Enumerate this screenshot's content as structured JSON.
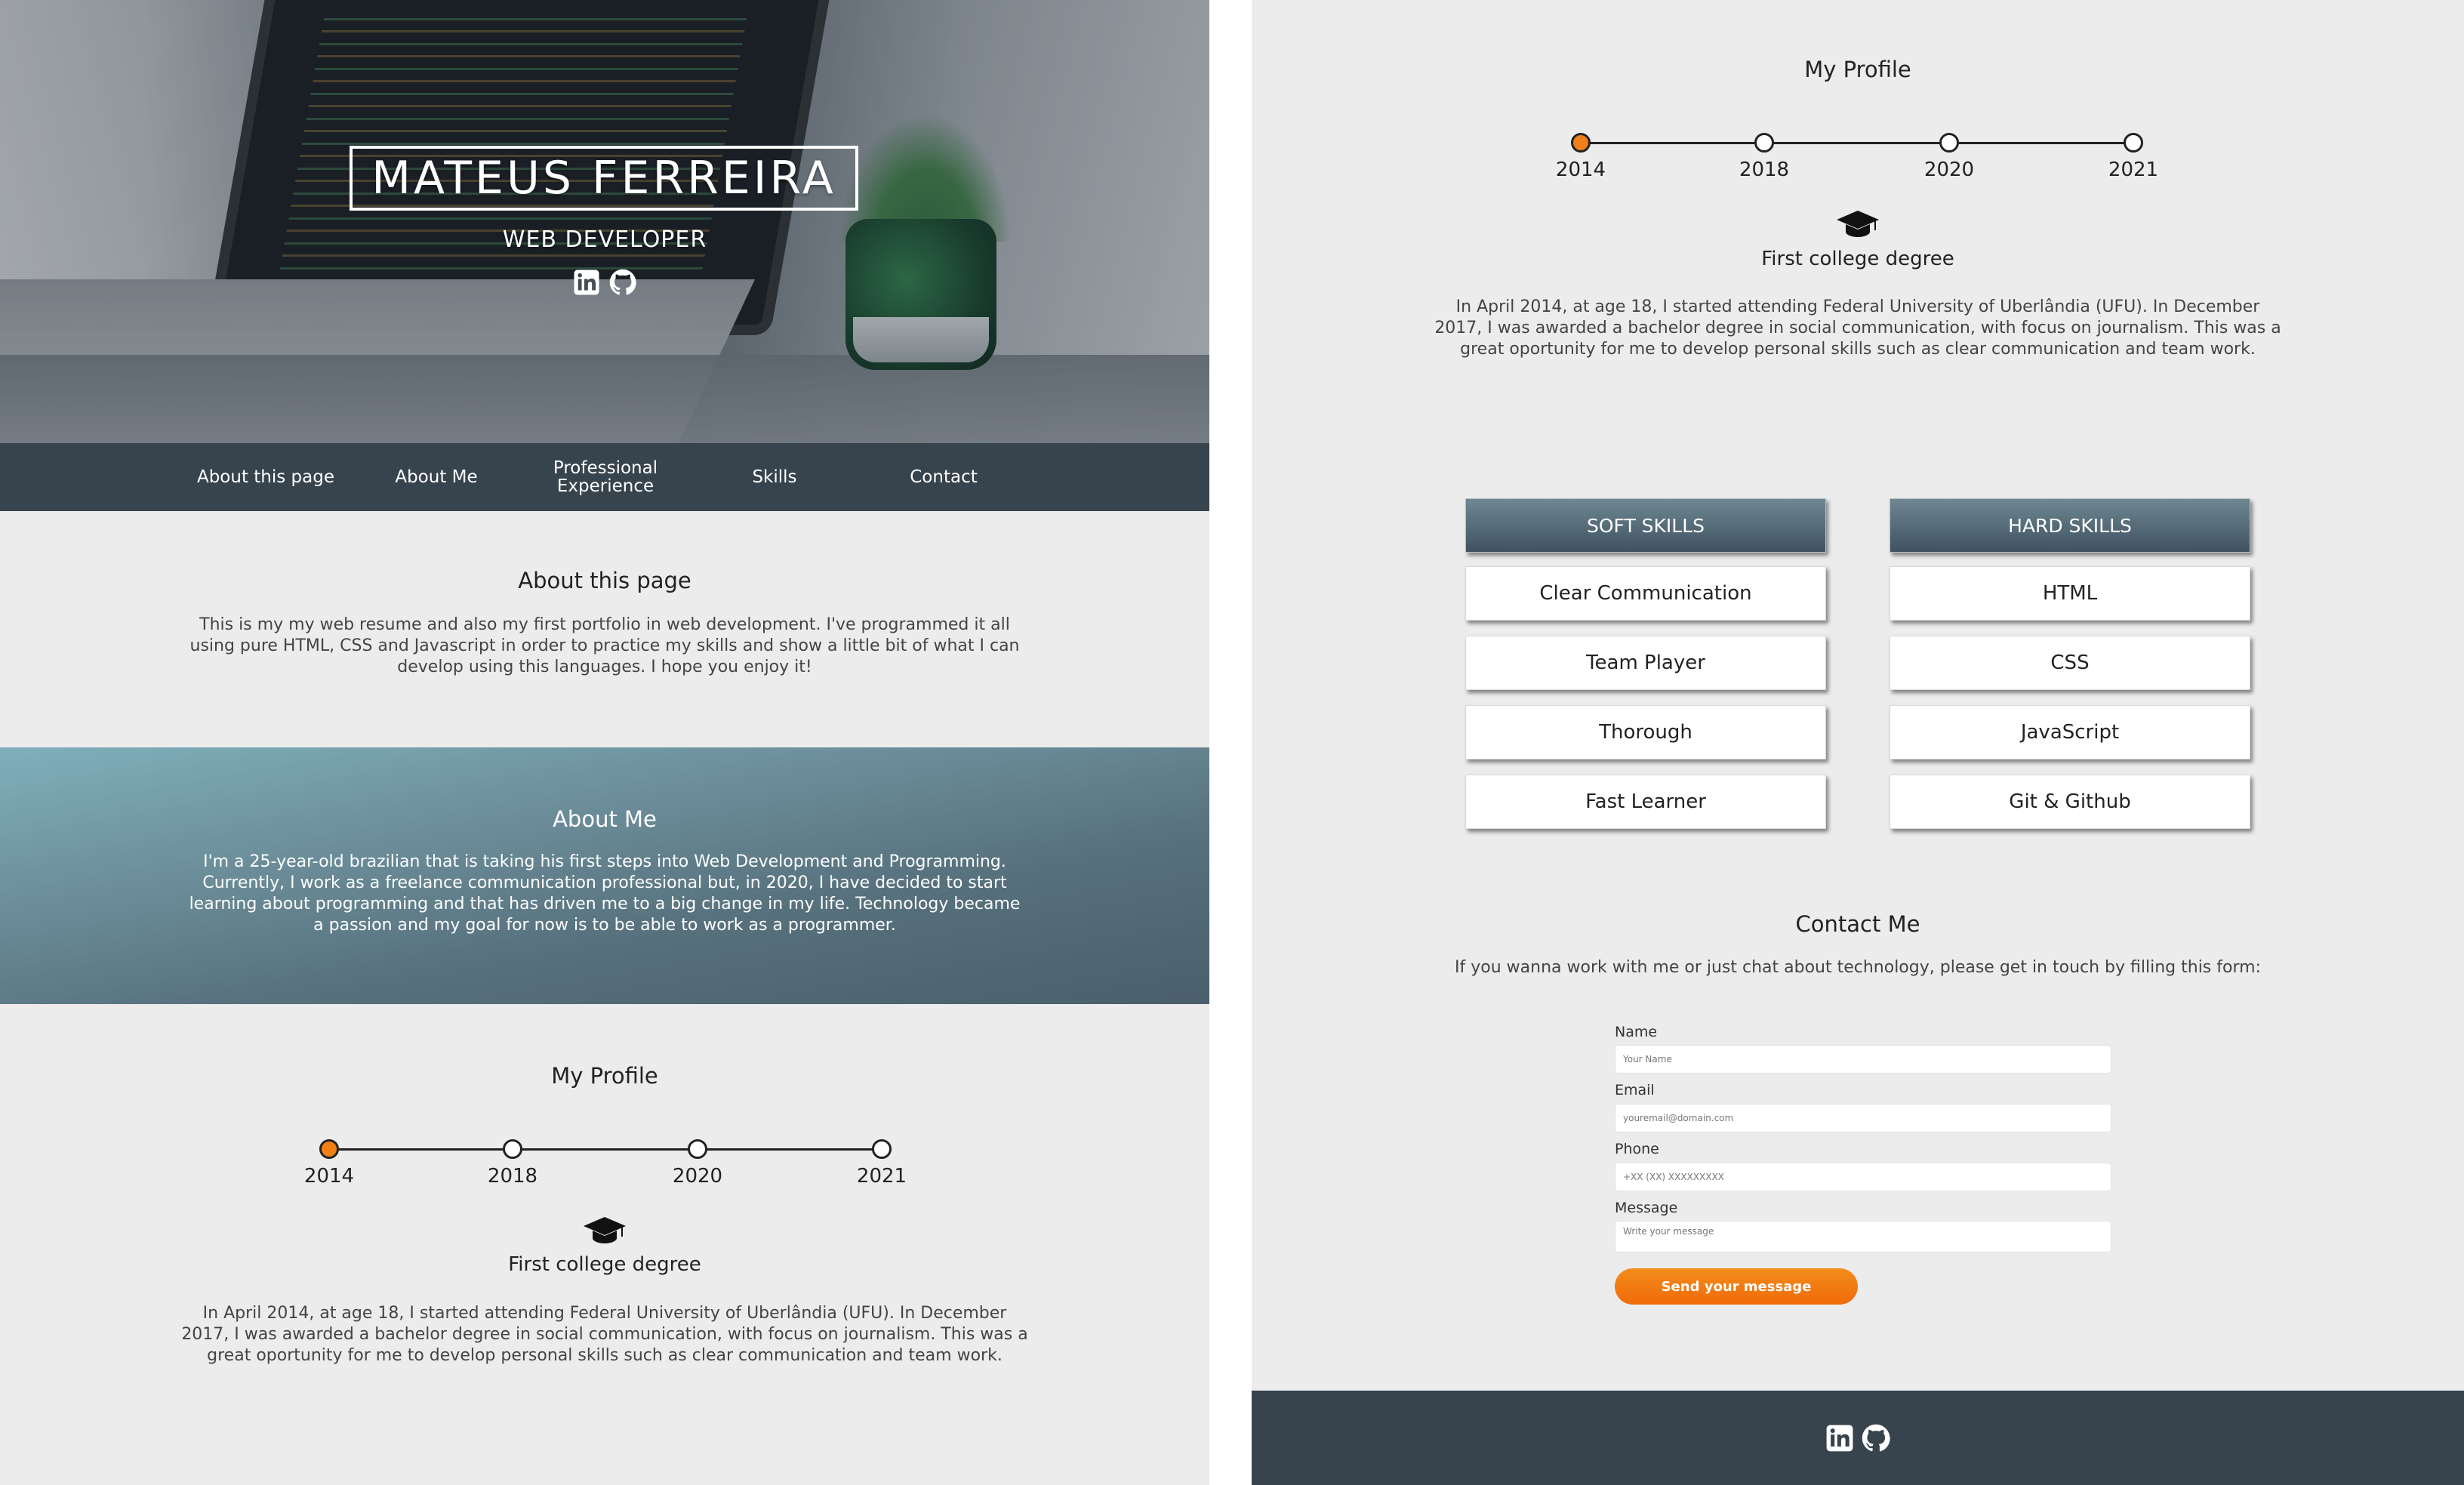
{
  "hero": {
    "name": "MATEUS FERREIRA",
    "role": "WEB DEVELOPER",
    "icons": [
      "linkedin-icon",
      "github-icon"
    ]
  },
  "nav": {
    "items": [
      "About this page",
      "About Me",
      "Professional Experience",
      "Skills",
      "Contact"
    ]
  },
  "about_page": {
    "title": "About this page",
    "text": "This is my my web resume and also my first portfolio in web development. I've programmed it all using pure HTML, CSS and Javascript in order to practice my skills and show a little bit of what I can develop using this languages. I hope you enjoy it!"
  },
  "about_me": {
    "title": "About Me",
    "text": "I'm a 25-year-old brazilian that is taking his first steps into Web Development and Programming. Currently, I work as a freelance communication professional but, in 2020, I have decided to start learning about programming and that has driven me to a big change in my life. Technology became a passion and my goal for now is to be able to work as a programmer."
  },
  "profile": {
    "title": "My Profile",
    "years": [
      "2014",
      "2018",
      "2020",
      "2021"
    ],
    "active_index": 0,
    "icon": "graduation-cap-icon",
    "degree_title": "First college degree",
    "degree_text": "In April 2014, at age 18, I started attending Federal University of Uberlândia (UFU). In December 2017, I was awarded a bachelor degree in social communication, with focus on journalism. This was a great oportunity for me to develop personal skills such as clear communication and team work."
  },
  "skills": {
    "soft_title": "SOFT SKILLS",
    "hard_title": "HARD SKILLS",
    "soft": [
      "Clear Communication",
      "Team Player",
      "Thorough",
      "Fast Learner"
    ],
    "hard": [
      "HTML",
      "CSS",
      "JavaScript",
      "Git & Github"
    ]
  },
  "contact": {
    "title": "Contact Me",
    "intro": "If you wanna work with me or just chat about technology, please get in touch by filling this form:",
    "fields": [
      {
        "label": "Name",
        "placeholder": "Your Name"
      },
      {
        "label": "Email",
        "placeholder": "youremail@domain.com"
      },
      {
        "label": "Phone",
        "placeholder": "+XX (XX) XXXXXXXXX"
      },
      {
        "label": "Message",
        "placeholder": "Write your message"
      }
    ],
    "send_label": "Send your message"
  },
  "footer": {
    "icons": [
      "linkedin-icon",
      "github-icon"
    ]
  },
  "colors": {
    "accent": "#ef7f16",
    "nav_bg": "#37434d",
    "page_bg": "#ececec"
  }
}
